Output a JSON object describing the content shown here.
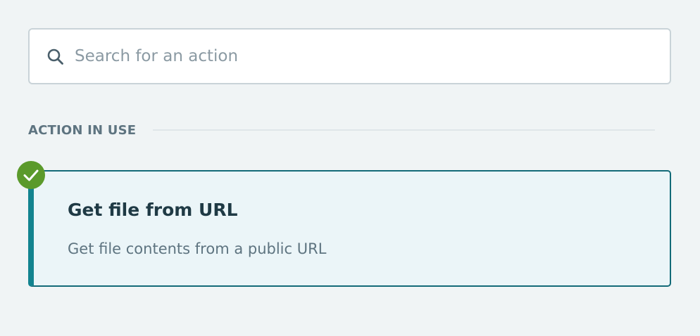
{
  "search": {
    "placeholder": "Search for an action",
    "value": "",
    "icon": "search-icon"
  },
  "section": {
    "title": "ACTION IN USE"
  },
  "action": {
    "title": "Get file from URL",
    "description": "Get file contents from a public URL",
    "status_icon": "check-icon",
    "selected": true
  },
  "colors": {
    "background": "#f0f4f5",
    "accent": "#12838f",
    "card_border": "#136a78",
    "card_background": "#ebf5f8",
    "check_badge": "#5b9a2b",
    "title_text": "#1f3a45",
    "muted_text": "#5e7480"
  }
}
